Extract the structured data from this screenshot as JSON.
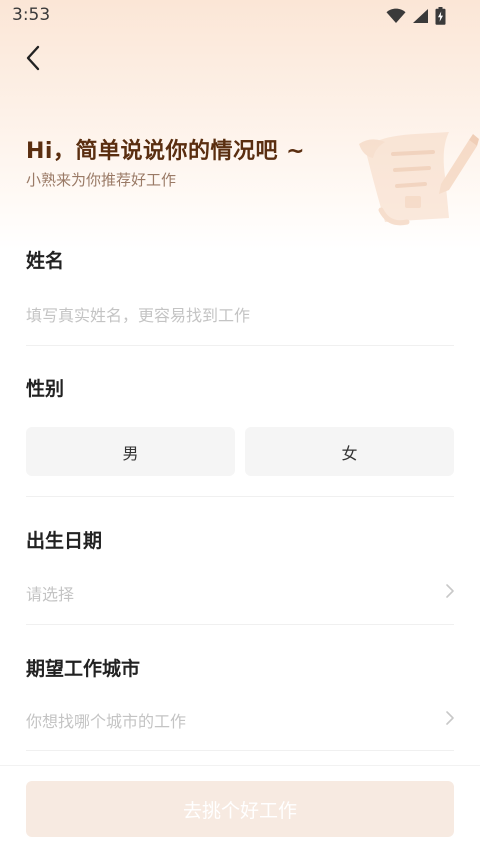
{
  "status_bar": {
    "time": "3:53",
    "icons": [
      "wifi-icon",
      "cellular-signal-icon",
      "battery-charging-icon"
    ]
  },
  "header": {
    "back_icon": "chevron-left-icon"
  },
  "hero": {
    "title": "Hi，简单说说你的情况吧 ~",
    "subtitle": "小熟来为你推荐好工作",
    "illustration": "resume-pencil-illustration"
  },
  "form": {
    "name": {
      "label": "姓名",
      "placeholder": "填写真实姓名，更容易找到工作"
    },
    "gender": {
      "label": "性别",
      "options": [
        "男",
        "女"
      ]
    },
    "birth_date": {
      "label": "出生日期",
      "placeholder": "请选择"
    },
    "city": {
      "label": "期望工作城市",
      "placeholder": "你想找哪个城市的工作"
    }
  },
  "submit": {
    "label": "去挑个好工作"
  },
  "colors": {
    "title_brown": "#5a2e10",
    "subtitle_brown": "#9a7a66",
    "button_disabled": "#f7eae1",
    "gradient_top": "#fbe6d6"
  }
}
